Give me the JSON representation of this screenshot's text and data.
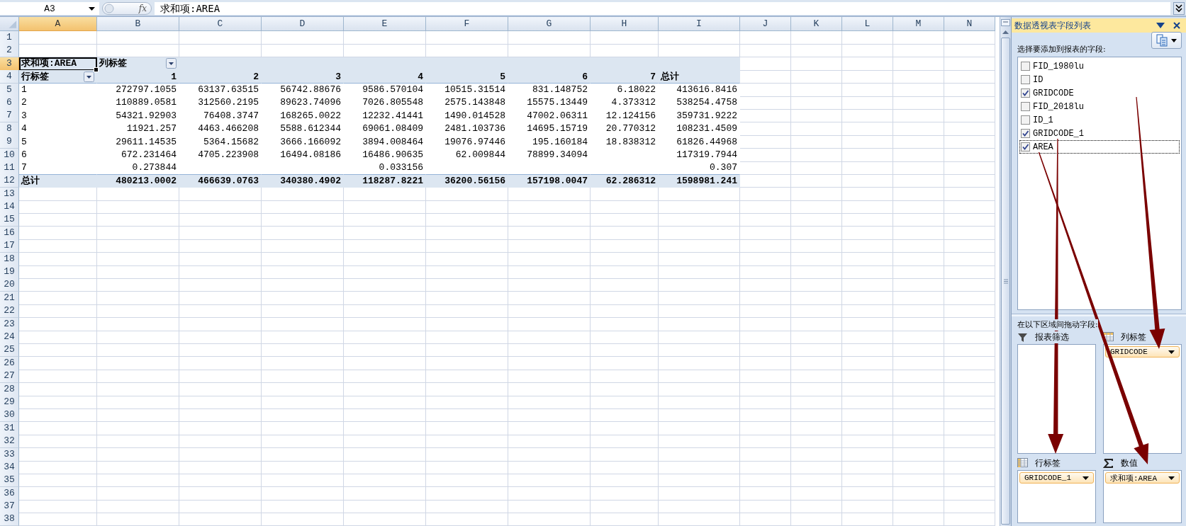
{
  "formula_bar": {
    "name_box": "A3",
    "function_button": "fx",
    "formula": "求和项:AREA"
  },
  "sheet": {
    "columns": [
      {
        "label": "A",
        "selected": true
      },
      {
        "label": "B",
        "selected": false
      },
      {
        "label": "C",
        "selected": false
      },
      {
        "label": "D",
        "selected": false
      },
      {
        "label": "E",
        "selected": false
      },
      {
        "label": "F",
        "selected": false
      },
      {
        "label": "G",
        "selected": false
      },
      {
        "label": "H",
        "selected": false
      },
      {
        "label": "I",
        "selected": false
      },
      {
        "label": "J",
        "selected": false
      },
      {
        "label": "K",
        "selected": false
      },
      {
        "label": "L",
        "selected": false
      },
      {
        "label": "M",
        "selected": false
      },
      {
        "label": "N",
        "selected": false
      }
    ],
    "rows": [
      {
        "label": "1",
        "selected": false,
        "kind": "blank"
      },
      {
        "label": "2",
        "selected": false,
        "kind": "blank"
      },
      {
        "label": "3",
        "selected": true,
        "kind": "pivot_header",
        "cells": [
          {
            "text": "求和项:AREA",
            "active": true
          },
          {
            "text": "列标签",
            "dropdown": true
          },
          null,
          null,
          null,
          null,
          null,
          null,
          null
        ]
      },
      {
        "label": "4",
        "selected": false,
        "kind": "pivot_labels",
        "cells": [
          {
            "text": "行标签",
            "dropdown": true
          },
          "1",
          "2",
          "3",
          "4",
          "5",
          "6",
          "7",
          {
            "text": "总计",
            "kind": "label"
          }
        ]
      },
      {
        "label": "5",
        "selected": false,
        "kind": "data",
        "cells": [
          "1",
          "272797.1055",
          "63137.63515",
          "56742.88676",
          "9586.570104",
          "10515.31514",
          "831.148752",
          "6.18022",
          "413616.8416"
        ]
      },
      {
        "label": "6",
        "selected": false,
        "kind": "data",
        "cells": [
          "2",
          "110889.0581",
          "312560.2195",
          "89623.74096",
          "7026.805548",
          "2575.143848",
          "15575.13449",
          "4.373312",
          "538254.4758"
        ]
      },
      {
        "label": "7",
        "selected": false,
        "kind": "data",
        "cells": [
          "3",
          "54321.92903",
          "76408.3747",
          "168265.0022",
          "12232.41441",
          "1490.014528",
          "47002.06311",
          "12.124156",
          "359731.9222"
        ]
      },
      {
        "label": "8",
        "selected": false,
        "kind": "data",
        "cells": [
          "4",
          "11921.257",
          "4463.466208",
          "5588.612344",
          "69061.08409",
          "2481.103736",
          "14695.15719",
          "20.770312",
          "108231.4509"
        ]
      },
      {
        "label": "9",
        "selected": false,
        "kind": "data",
        "cells": [
          "5",
          "29611.14535",
          "5364.15682",
          "3666.166092",
          "3894.008464",
          "19076.97446",
          "195.160184",
          "18.838312",
          "61826.44968"
        ]
      },
      {
        "label": "10",
        "selected": false,
        "kind": "data",
        "cells": [
          "6",
          "672.231464",
          "4705.223908",
          "16494.08186",
          "16486.90635",
          "62.009844",
          "78899.34094",
          null,
          "117319.7944"
        ]
      },
      {
        "label": "11",
        "selected": false,
        "kind": "data",
        "cells": [
          "7",
          "0.273844",
          null,
          null,
          "0.033156",
          null,
          null,
          null,
          "0.307"
        ]
      },
      {
        "label": "12",
        "selected": false,
        "kind": "total",
        "cells": [
          "总计",
          "480213.0002",
          "466639.0763",
          "340380.4902",
          "118287.8221",
          "36200.56156",
          "157198.0047",
          "62.286312",
          "1598981.241"
        ]
      },
      {
        "label": "13",
        "selected": false,
        "kind": "blank"
      },
      {
        "label": "14",
        "selected": false,
        "kind": "blank"
      },
      {
        "label": "15",
        "selected": false,
        "kind": "blank"
      },
      {
        "label": "16",
        "selected": false,
        "kind": "blank"
      },
      {
        "label": "17",
        "selected": false,
        "kind": "blank"
      },
      {
        "label": "18",
        "selected": false,
        "kind": "blank"
      },
      {
        "label": "19",
        "selected": false,
        "kind": "blank"
      },
      {
        "label": "20",
        "selected": false,
        "kind": "blank"
      },
      {
        "label": "21",
        "selected": false,
        "kind": "blank"
      },
      {
        "label": "22",
        "selected": false,
        "kind": "blank"
      },
      {
        "label": "23",
        "selected": false,
        "kind": "blank"
      },
      {
        "label": "24",
        "selected": false,
        "kind": "blank"
      },
      {
        "label": "25",
        "selected": false,
        "kind": "blank"
      },
      {
        "label": "26",
        "selected": false,
        "kind": "blank"
      },
      {
        "label": "27",
        "selected": false,
        "kind": "blank"
      },
      {
        "label": "28",
        "selected": false,
        "kind": "blank"
      },
      {
        "label": "29",
        "selected": false,
        "kind": "blank"
      },
      {
        "label": "30",
        "selected": false,
        "kind": "blank"
      },
      {
        "label": "31",
        "selected": false,
        "kind": "blank"
      },
      {
        "label": "32",
        "selected": false,
        "kind": "blank"
      },
      {
        "label": "33",
        "selected": false,
        "kind": "blank"
      },
      {
        "label": "34",
        "selected": false,
        "kind": "blank"
      },
      {
        "label": "35",
        "selected": false,
        "kind": "blank"
      },
      {
        "label": "36",
        "selected": false,
        "kind": "blank"
      },
      {
        "label": "37",
        "selected": false,
        "kind": "blank"
      },
      {
        "label": "38",
        "selected": false,
        "kind": "blank"
      }
    ]
  },
  "field_list": {
    "title": "数据透视表字段列表",
    "prompt": "选择要添加到报表的字段:",
    "fields": [
      {
        "label": "FID_1980lu",
        "checked": false,
        "selected": false
      },
      {
        "label": "ID",
        "checked": false,
        "selected": false
      },
      {
        "label": "GRIDCODE",
        "checked": true,
        "selected": false
      },
      {
        "label": "FID_2018lu",
        "checked": false,
        "selected": false
      },
      {
        "label": "ID_1",
        "checked": false,
        "selected": false
      },
      {
        "label": "GRIDCODE_1",
        "checked": true,
        "selected": false
      },
      {
        "label": "AREA",
        "checked": true,
        "selected": true
      }
    ],
    "drag_prompt": "在以下区域间拖动字段:",
    "areas": [
      {
        "kind": "filter",
        "label": "报表筛选"
      },
      {
        "kind": "columns",
        "label": "列标签",
        "items": [
          "GRIDCODE"
        ]
      },
      {
        "kind": "rows",
        "label": "行标签",
        "items": [
          "GRIDCODE_1"
        ]
      },
      {
        "kind": "values",
        "label": "数值",
        "items": [
          "求和项:AREA"
        ]
      }
    ]
  }
}
